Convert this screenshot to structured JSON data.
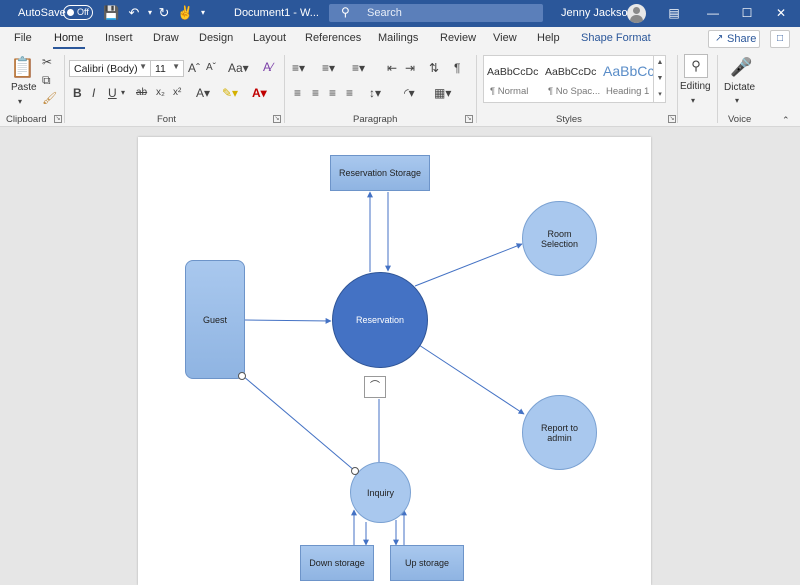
{
  "titlebar": {
    "autosave_label": "AutoSave",
    "autosave_state": "Off",
    "doc_title": "Document1 - W...",
    "search_placeholder": "Search",
    "user_name": "Jenny Jackson"
  },
  "tabs": {
    "file": "File",
    "home": "Home",
    "insert": "Insert",
    "draw": "Draw",
    "design": "Design",
    "layout": "Layout",
    "references": "References",
    "mailings": "Mailings",
    "review": "Review",
    "view": "View",
    "help": "Help",
    "shape_format": "Shape Format",
    "share": "Share"
  },
  "ribbon": {
    "clipboard": {
      "paste": "Paste",
      "label": "Clipboard"
    },
    "font": {
      "name": "Calibri (Body)",
      "size": "11",
      "label": "Font"
    },
    "paragraph": {
      "label": "Paragraph"
    },
    "styles": {
      "label": "Styles",
      "items": [
        {
          "sample": "AaBbCcDc",
          "name": "¶ Normal"
        },
        {
          "sample": "AaBbCcDc",
          "name": "¶ No Spac..."
        },
        {
          "sample": "AaBbCc",
          "name": "Heading 1"
        }
      ]
    },
    "editing": {
      "label": "Editing"
    },
    "voice": {
      "dictate": "Dictate",
      "label": "Voice"
    }
  },
  "diagram": {
    "reservation_storage": "Reservation Storage",
    "guest": "Guest",
    "reservation": "Reservation",
    "room_selection": "Room Selection",
    "report_to_admin": "Report to admin",
    "inquiry": "Inquiry",
    "down_storage": "Down storage",
    "up_storage": "Up storage"
  },
  "colors": {
    "titlebar": "#2b579a",
    "main_node": "#4472c4",
    "node_fill": "#a9c8ee",
    "connector": "#4472c4"
  }
}
